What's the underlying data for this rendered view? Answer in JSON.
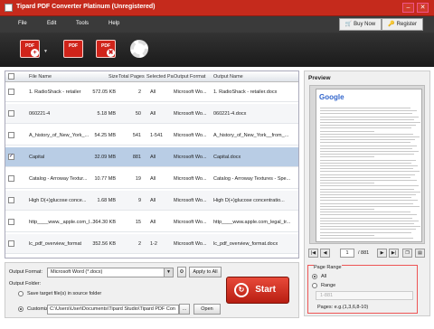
{
  "window": {
    "title": "Tipard PDF Converter Platinum (Unregistered)",
    "minimize": "–",
    "close": "✕"
  },
  "menu": [
    "File",
    "Edit",
    "Tools",
    "Help"
  ],
  "top_buttons": {
    "buy": "Buy Now",
    "register": "Register"
  },
  "toolbar": {
    "add_pdf": "PDF",
    "edit_pdf": "PDF",
    "remove_pdf": "PDF",
    "add_glyph": "+",
    "remove_glyph": "✖",
    "arrow": "▼"
  },
  "table": {
    "headers": [
      "File Name",
      "Size",
      "Total Pages",
      "Selected Pa",
      "Output Format",
      "Output Name"
    ],
    "rows": [
      {
        "name": "1. RadioShack - retailer",
        "size": "572.05 KB",
        "pages": "2",
        "selected": "All",
        "format": "Microsoft Wo...",
        "output": "1. RadioShack - retailer.docx",
        "checked": false
      },
      {
        "name": "060221-4",
        "size": "5.18 MB",
        "pages": "50",
        "selected": "All",
        "format": "Microsoft Wo...",
        "output": "060221-4.docx",
        "checked": false
      },
      {
        "name": "A_history_of_New_York_...",
        "size": "54.25 MB",
        "pages": "541",
        "selected": "1-541",
        "format": "Microsoft Wo...",
        "output": "A_history_of_New_York__from_...",
        "checked": false
      },
      {
        "name": "Capital",
        "size": "32.09 MB",
        "pages": "881",
        "selected": "All",
        "format": "Microsoft Wo...",
        "output": "Capital.docx",
        "checked": true
      },
      {
        "name": "Catalog - Arroway Textur...",
        "size": "10.77 MB",
        "pages": "19",
        "selected": "All",
        "format": "Microsoft Wo...",
        "output": "Catalog - Arroway Textures - Spe...",
        "checked": false
      },
      {
        "name": "High D(+)glucose conce...",
        "size": "1.68 MB",
        "pages": "9",
        "selected": "All",
        "format": "Microsoft Wo...",
        "output": "High D(+)glucose concentratio...",
        "checked": false
      },
      {
        "name": "http____www._apple.com_l...",
        "size": "364.30 KB",
        "pages": "15",
        "selected": "All",
        "format": "Microsoft Wo...",
        "output": "http____www.apple.com_legal_tr...",
        "checked": false
      },
      {
        "name": "lc_pdf_overview_format",
        "size": "352.56 KB",
        "pages": "2",
        "selected": "1-2",
        "format": "Microsoft Wo...",
        "output": "lc_pdf_overview_format.docx",
        "checked": false
      }
    ]
  },
  "output": {
    "format_label": "Output Format:",
    "format_value": "Microsoft Word (*.docx)",
    "apply_all": "Apply to All",
    "folder_label": "Output Folder:",
    "save_source": "Save target file(s) in source folder",
    "customize": "Customize:",
    "path": "C:\\Users\\User\\Documents\\Tipard Studio\\Tipard PDF Con",
    "browse": "...",
    "open": "Open"
  },
  "start": {
    "label": "Start",
    "icon": "↻"
  },
  "preview": {
    "title": "Preview",
    "google": "Google",
    "page_current": "1",
    "page_total": "/ 881",
    "nav": [
      "|◀",
      "◀",
      "▶",
      "▶|"
    ]
  },
  "page_range": {
    "title": "Page Range",
    "all": "All",
    "range": "Range",
    "placeholder": "1-881",
    "hint": "Pages: e.g.(1,3,6,8-10)"
  }
}
